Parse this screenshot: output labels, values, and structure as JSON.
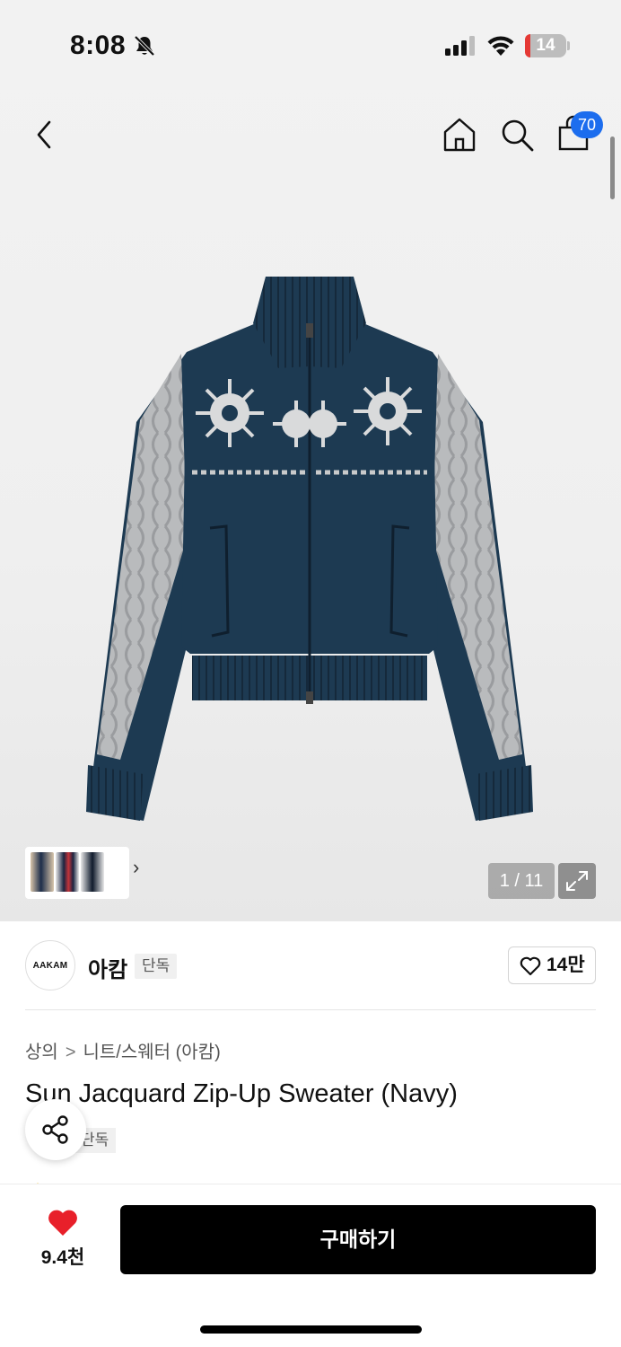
{
  "status_bar": {
    "time": "8:08",
    "battery_level": "14",
    "battery_fraction": 0.14,
    "icons": [
      "bell-slash-icon",
      "cellular-signal-icon",
      "wifi-icon",
      "battery-icon"
    ]
  },
  "nav": {
    "icons": [
      "back-arrow-icon",
      "home-icon",
      "search-icon",
      "shopping-bag-icon"
    ],
    "cart_count": "70"
  },
  "gallery": {
    "counter": "1 / 11",
    "icons": [
      "chevron-right-icon",
      "expand-icon"
    ]
  },
  "brand": {
    "logo_text": "AAKAM",
    "name": "아캄",
    "tag": "단독",
    "like_count": "14만",
    "like_icon": "heart-outline-icon"
  },
  "breadcrumb": {
    "items": [
      "상의",
      "니트/스웨터 (아캄)"
    ],
    "separator": ">"
  },
  "product": {
    "title": "Sun Jacquard Zip-Up Sweater (Navy)",
    "exclusive_tag": "단독"
  },
  "share": {
    "icon": "share-icon"
  },
  "bottom_bar": {
    "wish_icon": "heart-filled-icon",
    "wish_count": "9.4천",
    "buy_label": "구매하기"
  },
  "colors": {
    "accent_blue": "#1c6dee",
    "heart_red": "#e8202a",
    "buy_button": "#000000",
    "sweater_navy": "#1d3a52",
    "sleeve_gray": "#b4b6b8"
  }
}
